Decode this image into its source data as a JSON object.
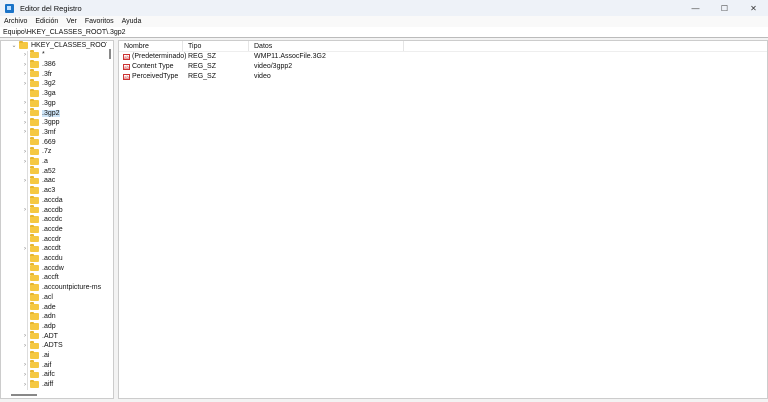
{
  "window": {
    "title": "Editor del Registro",
    "minimize": "—",
    "maximize": "☐",
    "close": "✕"
  },
  "menu": [
    "Archivo",
    "Edición",
    "Ver",
    "Favoritos",
    "Ayuda"
  ],
  "address": "Equipo\\HKEY_CLASSES_ROOT\\.3gp2",
  "tree": {
    "root": "HKEY_CLASSES_ROOT",
    "selected": ".3gp2",
    "items": [
      {
        "label": "*",
        "expandable": true
      },
      {
        "label": ".386",
        "expandable": true
      },
      {
        "label": ".3fr",
        "expandable": true
      },
      {
        "label": ".3g2",
        "expandable": true
      },
      {
        "label": ".3ga",
        "expandable": false
      },
      {
        "label": ".3gp",
        "expandable": true
      },
      {
        "label": ".3gp2",
        "expandable": true
      },
      {
        "label": ".3gpp",
        "expandable": true
      },
      {
        "label": ".3mf",
        "expandable": true
      },
      {
        "label": ".669",
        "expandable": false
      },
      {
        "label": ".7z",
        "expandable": true
      },
      {
        "label": ".a",
        "expandable": true
      },
      {
        "label": ".a52",
        "expandable": false
      },
      {
        "label": ".aac",
        "expandable": true
      },
      {
        "label": ".ac3",
        "expandable": false
      },
      {
        "label": ".accda",
        "expandable": false
      },
      {
        "label": ".accdb",
        "expandable": true
      },
      {
        "label": ".accdc",
        "expandable": false
      },
      {
        "label": ".accde",
        "expandable": false
      },
      {
        "label": ".accdr",
        "expandable": false
      },
      {
        "label": ".accdt",
        "expandable": true
      },
      {
        "label": ".accdu",
        "expandable": false
      },
      {
        "label": ".accdw",
        "expandable": false
      },
      {
        "label": ".accft",
        "expandable": false
      },
      {
        "label": ".accountpicture-ms",
        "expandable": false
      },
      {
        "label": ".acl",
        "expandable": false
      },
      {
        "label": ".ade",
        "expandable": false
      },
      {
        "label": ".adn",
        "expandable": false
      },
      {
        "label": ".adp",
        "expandable": false
      },
      {
        "label": ".ADT",
        "expandable": true
      },
      {
        "label": ".ADTS",
        "expandable": true
      },
      {
        "label": ".ai",
        "expandable": false
      },
      {
        "label": ".aif",
        "expandable": true
      },
      {
        "label": ".aifc",
        "expandable": true
      },
      {
        "label": ".aiff",
        "expandable": true
      }
    ]
  },
  "list": {
    "columns": [
      "Nombre",
      "Tipo",
      "Datos"
    ],
    "rows": [
      {
        "name": "(Predeterminado)",
        "type": "REG_SZ",
        "data": "WMP11.AssocFile.3G2"
      },
      {
        "name": "Content Type",
        "type": "REG_SZ",
        "data": "video/3gpp2"
      },
      {
        "name": "PerceivedType",
        "type": "REG_SZ",
        "data": "video"
      }
    ]
  }
}
